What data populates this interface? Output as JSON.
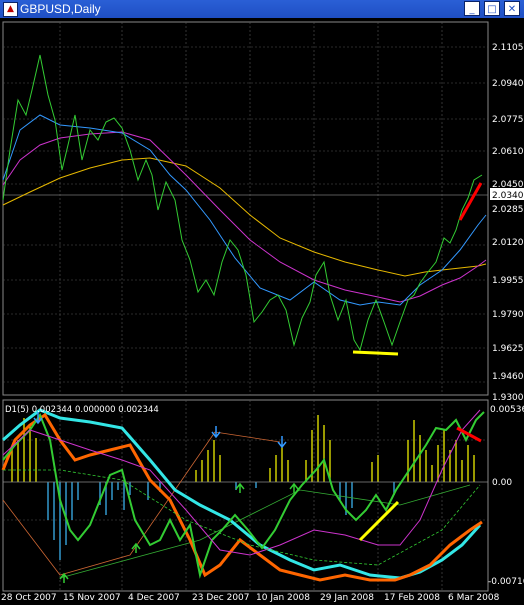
{
  "window": {
    "title": "GBPUSD,Daily",
    "icon": "chart-window-icon",
    "buttons": [
      "minimize",
      "maximize",
      "close"
    ]
  },
  "colors": {
    "background": "#000000",
    "price": "#33cc33",
    "ma_fast": "#3399ff",
    "ma_mid": "#cc33cc",
    "ma_slow": "#ffcc33",
    "ind_cyan": "#33e6e6",
    "ind_orange": "#ff6600",
    "histogram_pos": "#cccc00",
    "histogram_neg": "#3399cc",
    "trend_red": "#ff0000",
    "trend_yellow": "#ffff00"
  },
  "price_axis": {
    "labels": [
      "2.1105",
      "2.0940",
      "2.0775",
      "2.0610",
      "2.0450",
      "2.0340",
      "2.0285",
      "2.0120",
      "1.9955",
      "1.9790",
      "1.9625",
      "1.9460",
      "1.9300"
    ],
    "current_price": "2.0340"
  },
  "indicator": {
    "title": "D1(5) 0.002344 0.000000 0.002344",
    "axis_labels": [
      "0.00536",
      "0.00",
      "-0.00716"
    ]
  },
  "dates": [
    "28 Oct 2007",
    "15 Nov 2007",
    "4 Dec 2007",
    "23 Dec 2007",
    "10 Jan 2008",
    "29 Jan 2008",
    "17 Feb 2008",
    "6 Mar 2008"
  ]
}
